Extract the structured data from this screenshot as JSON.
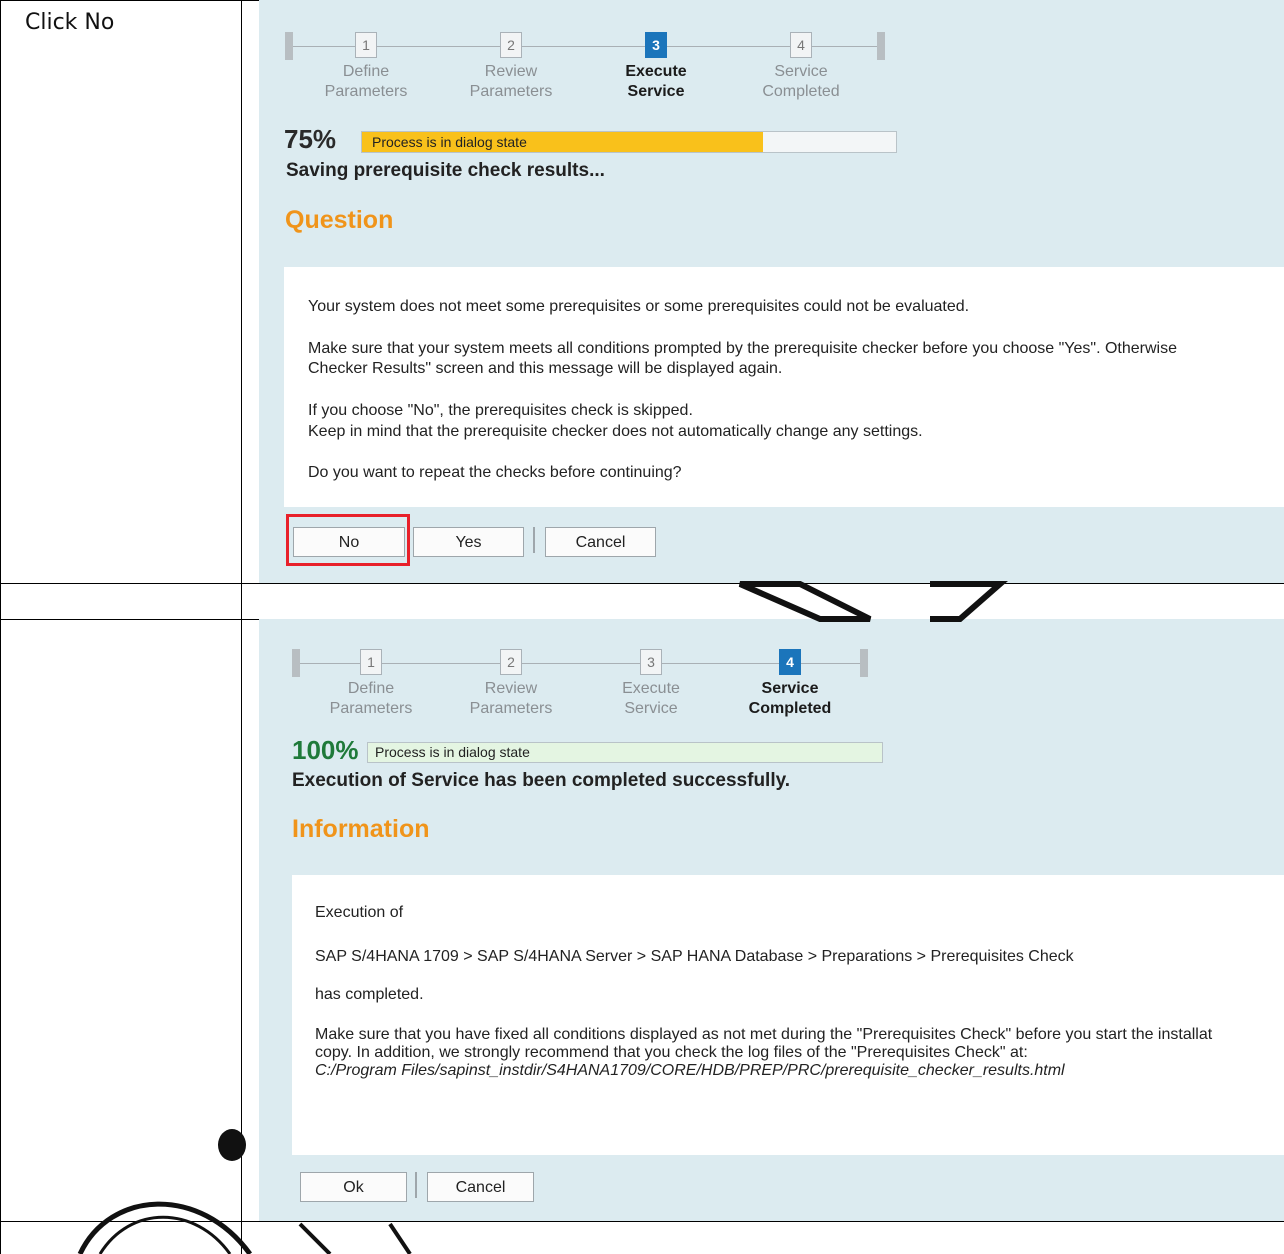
{
  "instruction_text": "Click No",
  "steps_labels": {
    "s1_num": "1",
    "s1_line1": "Define",
    "s1_line2": "Parameters",
    "s2_num": "2",
    "s2_line1": "Review",
    "s2_line2": "Parameters",
    "s3_num": "3",
    "s3_line1": "Execute",
    "s3_line2": "Service",
    "s4_num": "4",
    "s4_line1": "Service",
    "s4_line2": "Completed"
  },
  "dialog1": {
    "percent": "75%",
    "progress_value": 0.75,
    "progress_text": "Process is in dialog state",
    "status": "Saving prerequisite check results...",
    "heading": "Question",
    "message": [
      "Your system does not meet some prerequisites or some prerequisites could not be evaluated.",
      "Make sure that your system meets all conditions prompted by the prerequisite checker before you choose \"Yes\". Otherwise",
      "Checker Results\" screen and this message will be displayed again.",
      "If you choose \"No\", the prerequisites check is skipped.",
      "Keep in mind that the prerequisite checker does not automatically change any settings.",
      "Do you want to repeat the checks before continuing?"
    ],
    "buttons": {
      "no": "No",
      "yes": "Yes",
      "cancel": "Cancel"
    },
    "active_step": 3
  },
  "dialog2": {
    "percent": "100%",
    "progress_value": 1.0,
    "progress_text": "Process is in dialog state",
    "status": "Execution of Service has been completed successfully.",
    "heading": "Information",
    "message": [
      "Execution of",
      "SAP S/4HANA 1709 > SAP S/4HANA Server > SAP HANA Database > Preparations > Prerequisites Check",
      "has completed.",
      "Make sure that you have fixed all conditions displayed as not met during the \"Prerequisites Check\" before you start the installat",
      "copy. In addition, we strongly recommend that you check the log files of the \"Prerequisites Check\" at:",
      "C:/Program Files/sapinst_instdir/S4HANA1709/CORE/HDB/PREP/PRC/prerequisite_checker_results.html"
    ],
    "buttons": {
      "ok": "Ok",
      "cancel": "Cancel"
    },
    "active_step": 4
  },
  "colors": {
    "accent_blue": "#1b75bb",
    "heading_orange": "#f0941a",
    "progress_yellow": "#f9c11b",
    "progress_green": "#e4f5e2",
    "highlight_red": "#e8202a",
    "percent_green": "#1f7a3a"
  }
}
